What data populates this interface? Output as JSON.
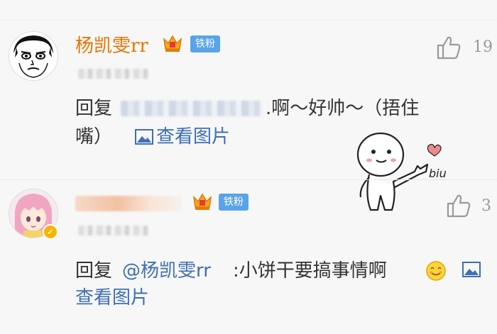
{
  "comments": [
    {
      "username": "杨凯雯rr",
      "fan_badge": "铁粉",
      "likes": "19",
      "reply_prefix": "回复",
      "reply_text_1": ".啊～好帅～（捂住",
      "reply_text_2": "嘴）",
      "view_image": "查看图片"
    },
    {
      "fan_badge": "铁粉",
      "likes": "3",
      "reply_prefix": "回复",
      "mention": "@杨凯雯rr",
      "reply_text": ":小饼干要搞事情啊",
      "view_image": "查看图片"
    }
  ],
  "sticker_text": "biu",
  "colors": {
    "username": "#e87400",
    "link": "#3d6fb6",
    "fan_badge": "#5aa3e8",
    "background": "#f7f7f7"
  },
  "icons": [
    "thumbs-up-icon",
    "image-icon",
    "crown-icon",
    "verified-icon",
    "smile-emoji-icon"
  ]
}
